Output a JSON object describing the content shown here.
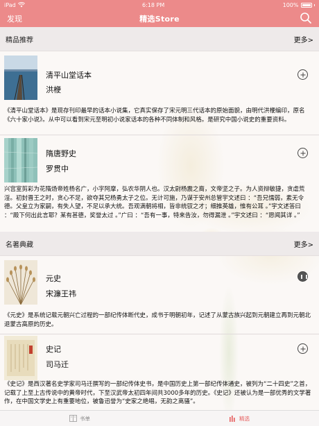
{
  "status_bar": {
    "device": "iPad",
    "time": "6:18 PM",
    "battery": "100%"
  },
  "nav": {
    "left_label": "发现",
    "title": "精选Store"
  },
  "colors": {
    "accent": "#ec8a8a",
    "tab_active": "#e65a5a",
    "section_bg": "#eeeaea"
  },
  "sections": [
    {
      "title": "精品推荐",
      "more": "更多>",
      "books": [
        {
          "title": "清平山堂话本",
          "author": "洪楩",
          "action_icon": "add-icon",
          "description": "《清平山堂话本》是现存刊印最早的话本小说集，它真实保存了宋元明三代话本的原始面貌，由明代洪楩编印，原名《六十家小说》。从中可以看到宋元至明初小说家话本的各种不同体制和风格。是研究中国小说史的重要资料。"
        },
        {
          "title": "隋唐野史",
          "author": "罗贯中",
          "action_icon": "add-icon",
          "description": "兴宫室剪彩为花隋炀帝姓杨名广，小字阿摩，弘农华阴人也。汉太尉杨震之裔，文帝坚之子。为人资辩敏捷，贪虐荒淫。初封晋王之时，贪心不足，欲夺其兄杨勇太子之位。无计可施，乃谋于安州总管宇文述曰 ：“吾兄懦弱，素无令德。父皇立为家嗣，有失人望，不足以承大统。吾观满朝将相，皆非统驭之才；细推英雄，惟有公耳 。”宇文述答曰 ：“殿下何出此言耶？某有甚德，奖誉太过 。”广曰 ：“吾有一事，特来告汝，勿得漏泄 。”宇文述曰 ：“愿闻其详 。”"
        }
      ]
    },
    {
      "title": "名著典藏",
      "more": "更多>",
      "books": [
        {
          "title": "元史",
          "author": "宋濂王祎",
          "action_icon": "pause-icon",
          "description": "《元史》是系统记载元朝兴亡过程的一部纪传体断代史，成书于明朝初年，记述了从蒙古族兴起到元朝建立再到元朝北退蒙古高原的历史。"
        },
        {
          "title": "史记",
          "author": "司马迁",
          "action_icon": "add-icon",
          "description": "《史记》是西汉著名史学家司马迁撰写的一部纪传体史书，是中国历史上第一部纪传体通史，被列为“二十四史”之首，记载了上至上古传说中的黄帝时代，下至汉武帝太初四年间共3000多年的历史。《史记》还被认为是一部优秀的文学著作，在中国文学史上有重要地位，被鲁迅誉为“史家之绝唱，无韵之离骚”。"
        }
      ]
    }
  ],
  "tabs": [
    {
      "label": "书单",
      "icon": "book-list-icon",
      "active": false
    },
    {
      "label": "精选",
      "icon": "featured-icon",
      "active": true
    }
  ]
}
